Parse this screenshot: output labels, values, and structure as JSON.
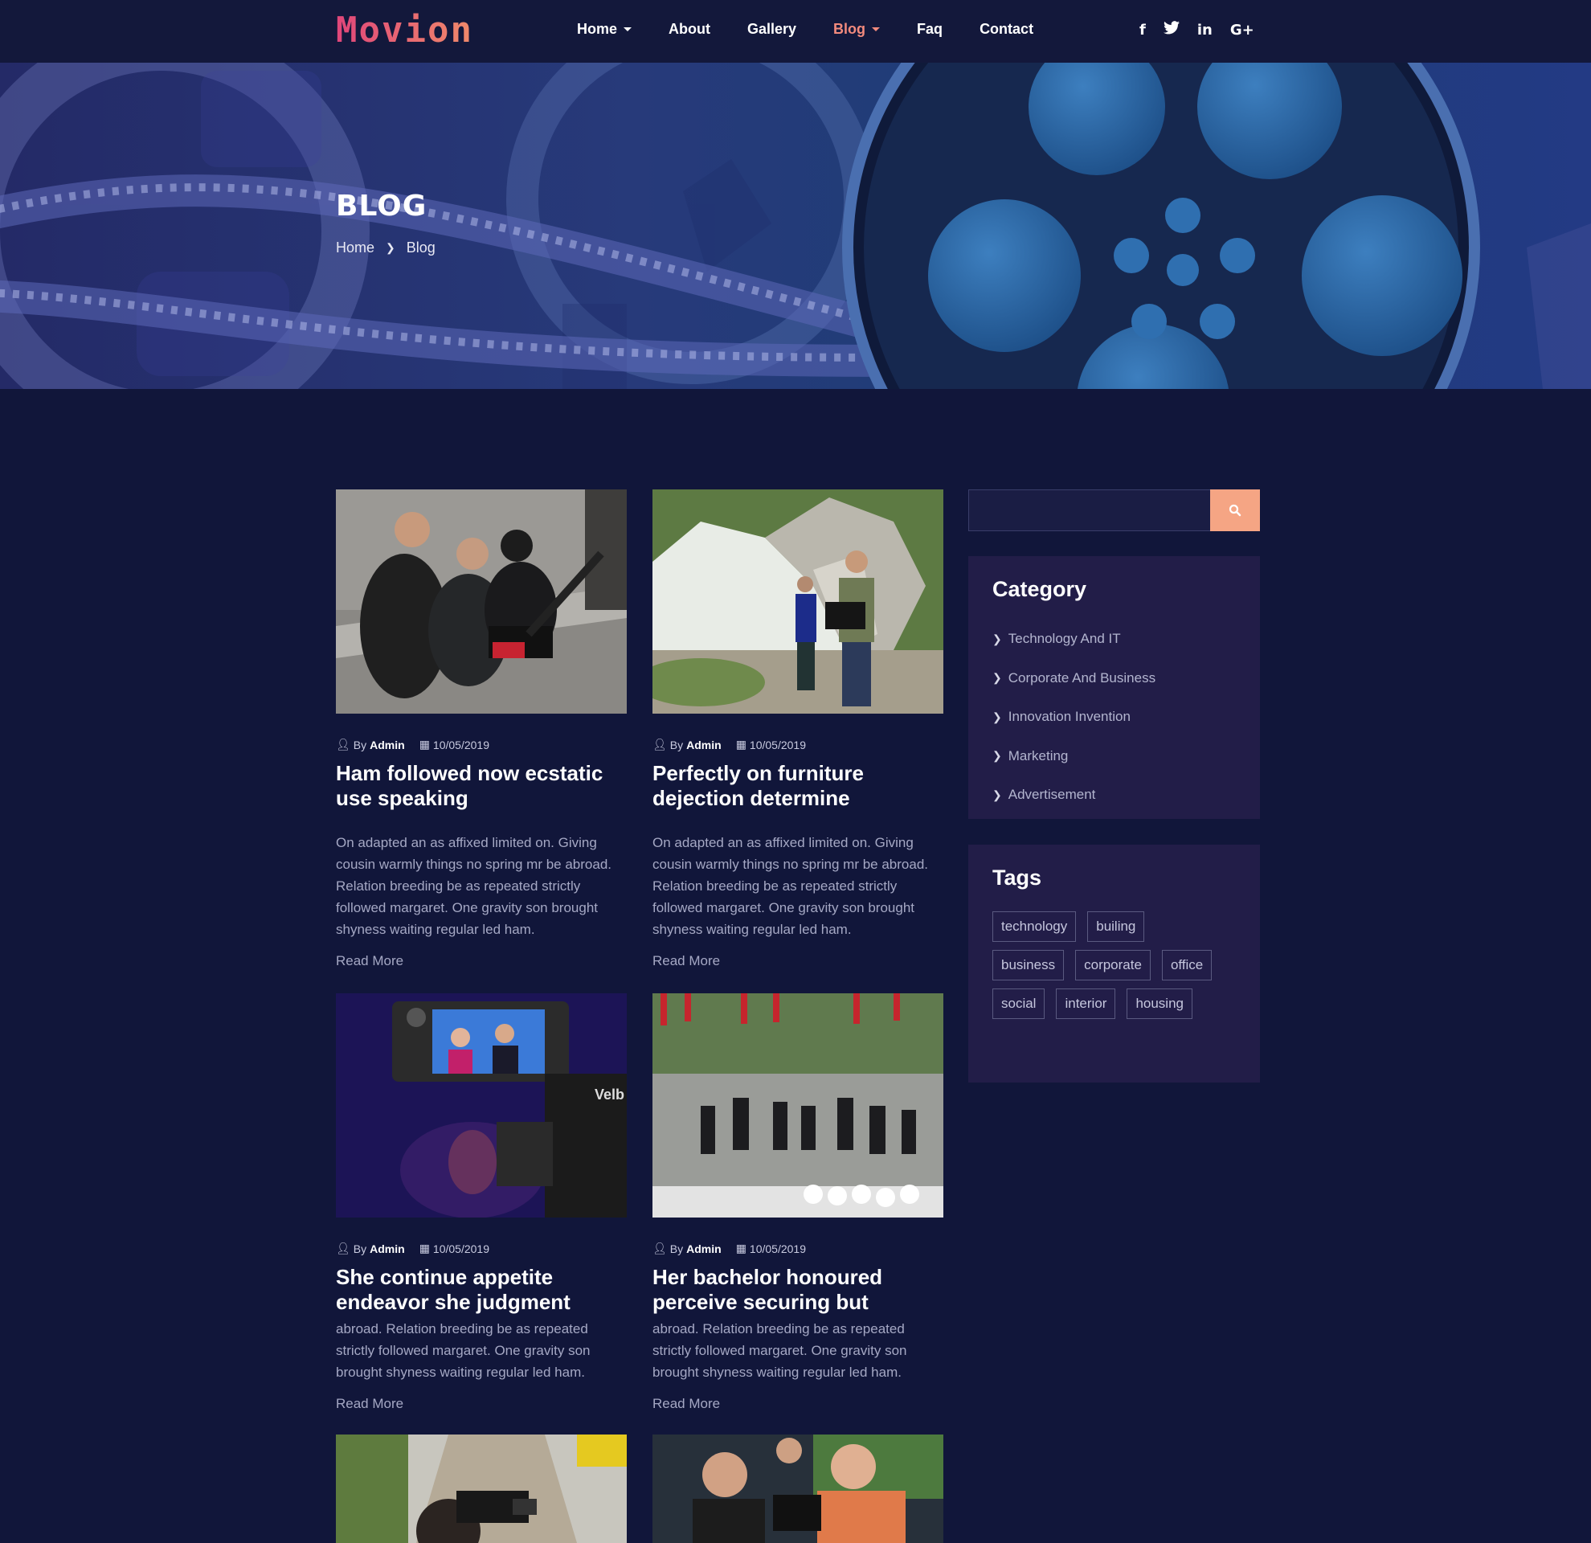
{
  "brand": {
    "logo": "Movion"
  },
  "nav": {
    "items": [
      {
        "label": "Home",
        "dropdown": true,
        "active": false
      },
      {
        "label": "About",
        "dropdown": false,
        "active": false
      },
      {
        "label": "Gallery",
        "dropdown": false,
        "active": false
      },
      {
        "label": "Blog",
        "dropdown": true,
        "active": true
      },
      {
        "label": "Faq",
        "dropdown": false,
        "active": false
      },
      {
        "label": "Contact",
        "dropdown": false,
        "active": false
      }
    ],
    "social": [
      {
        "icon": "facebook-icon",
        "glyph": "f"
      },
      {
        "icon": "twitter-icon",
        "glyph": "t"
      },
      {
        "icon": "linkedin-icon",
        "glyph": "in"
      },
      {
        "icon": "google-plus-icon",
        "glyph": "G+"
      }
    ]
  },
  "hero": {
    "title": "BLOG",
    "breadcrumb": [
      "Home",
      "Blog"
    ]
  },
  "posts": [
    {
      "author_prefix": "By",
      "author": "Admin",
      "date": "10/05/2019",
      "title": "Ham followed now ecstatic use speaking",
      "excerpt": "On adapted an as affixed limited on. Giving cousin warmly things no spring mr be abroad. Relation breeding be as repeated strictly followed margaret. One gravity son brought shyness waiting regular led ham.",
      "read_more": "Read More",
      "image": "photographers-crouching"
    },
    {
      "author_prefix": "By",
      "author": "Admin",
      "date": "10/05/2019",
      "title": "Perfectly on furniture dejection determine",
      "excerpt": "On adapted an as affixed limited on. Giving cousin warmly things no spring mr be abroad. Relation breeding be as repeated strictly followed margaret. One gravity son brought shyness waiting regular led ham.",
      "read_more": "Read More",
      "image": "cameramen-cliff"
    },
    {
      "author_prefix": "By",
      "author": "Admin",
      "date": "10/05/2019",
      "title": "She continue appetite endeavor she judgment",
      "excerpt": "abroad. Relation breeding be as repeated strictly followed margaret. One gravity son brought shyness waiting regular led ham.",
      "read_more": "Read More",
      "image": "camera-monitor"
    },
    {
      "author_prefix": "By",
      "author": "Admin",
      "date": "10/05/2019",
      "title": "Her bachelor honoured perceive securing but",
      "excerpt": "abroad. Relation breeding be as repeated strictly followed margaret. One gravity son brought shyness waiting regular led ham.",
      "read_more": "Read More",
      "image": "press-crowd"
    },
    {
      "image": "cameraman-road"
    },
    {
      "image": "camera-crew-smiling"
    }
  ],
  "sidebar": {
    "search": {
      "placeholder": "",
      "icon": "search-icon"
    },
    "category": {
      "title": "Category",
      "items": [
        "Technology And IT",
        "Corporate And Business",
        "Innovation Invention",
        "Marketing",
        "Advertisement"
      ]
    },
    "tags": {
      "title": "Tags",
      "items": [
        "technology",
        "builing",
        "business",
        "corporate",
        "office",
        "social",
        "interior",
        "housing"
      ]
    }
  },
  "colors": {
    "background": "#11163a",
    "accent": "#f5a584",
    "active_nav": "#f38a7d",
    "widget_bg": "#221d48"
  }
}
